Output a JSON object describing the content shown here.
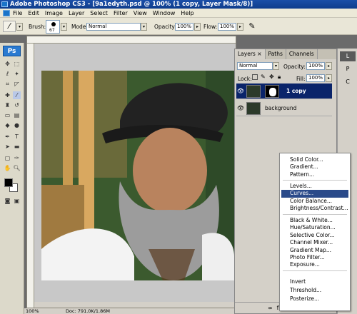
{
  "window": {
    "title": "Adobe Photoshop CS3 - [9a1edyth.psd @ 100% (1 copy, Layer Mask/8)]"
  },
  "menu": {
    "items": [
      "File",
      "Edit",
      "Image",
      "Layer",
      "Select",
      "Filter",
      "View",
      "Window",
      "Help"
    ]
  },
  "options": {
    "brush_label": "Brush:",
    "brush_size": "67",
    "mode_label": "Mode:",
    "mode_value": "Normal",
    "opacity_label": "Opacity:",
    "opacity_value": "100%",
    "flow_label": "Flow:",
    "flow_value": "100%"
  },
  "toolbox": {
    "logo": "Ps"
  },
  "status": {
    "zoom": "100%",
    "doc": "Doc: 791.0K/1.86M"
  },
  "layers_panel": {
    "tabs": [
      "Layers",
      "Paths",
      "Channels"
    ],
    "tab_close": "×",
    "blend_mode": "Normal",
    "opacity_label": "Opacity:",
    "opacity_value": "100%",
    "lock_label": "Lock:",
    "fill_label": "Fill:",
    "fill_value": "100%",
    "layers": [
      {
        "name": "1 copy",
        "selected": true
      },
      {
        "name": "background",
        "selected": false
      }
    ]
  },
  "right_dock": {
    "letters": [
      "L",
      "P",
      "C"
    ]
  },
  "adjustment_menu": {
    "items": [
      "Solid Color...",
      "Gradient...",
      "Pattern...",
      "Levels...",
      "Curves...",
      "Color Balance...",
      "Brightness/Contrast...",
      "Black & White...",
      "Hue/Saturation...",
      "Selective Color...",
      "Channel Mixer...",
      "Gradient Map...",
      "Photo Filter...",
      "Exposure...",
      "Invert",
      "Threshold...",
      "Posterize..."
    ],
    "selected": "Curves..."
  },
  "colors": {
    "title_bar": "#1b4fa8",
    "selected_row": "#0a246a",
    "menu_highlight": "#2a4a8a"
  }
}
